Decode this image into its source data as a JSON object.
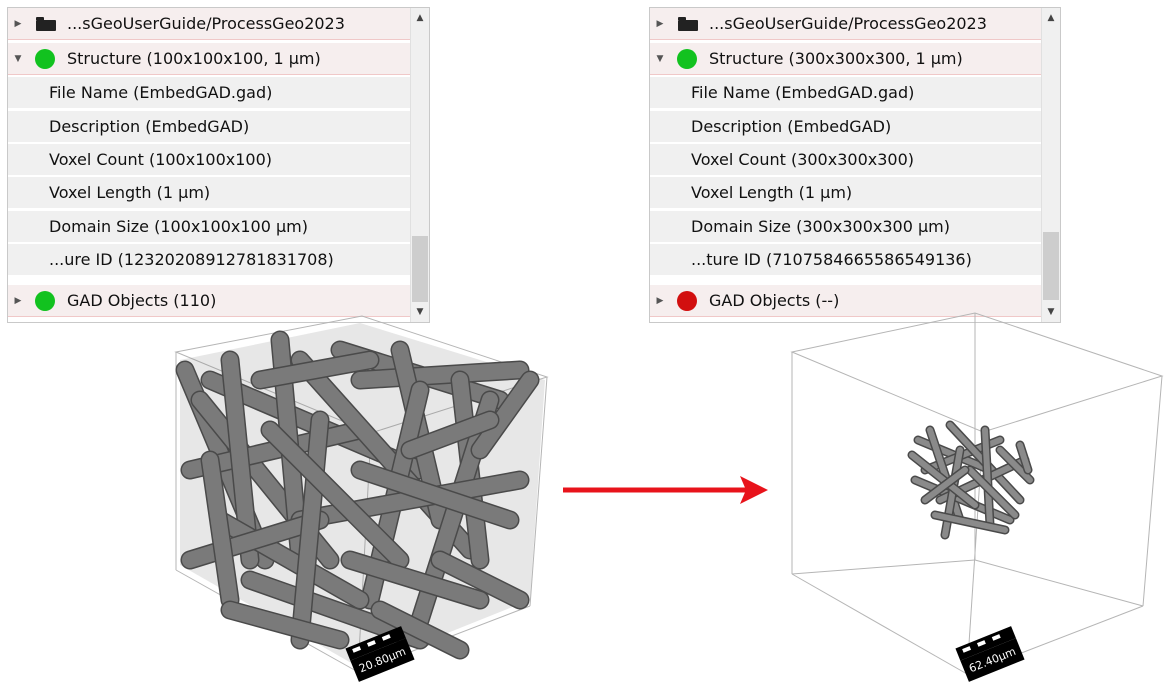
{
  "panels": {
    "left": {
      "rows": [
        {
          "type": "folder",
          "label": "...sGeoUserGuide/ProcessGeo2023",
          "expanded": false
        },
        {
          "type": "status",
          "label": "Structure (100x100x100, 1 µm)",
          "status": "green",
          "expanded": true
        },
        {
          "type": "child",
          "label": "File Name (EmbedGAD.gad)"
        },
        {
          "type": "child",
          "label": "Description (EmbedGAD)"
        },
        {
          "type": "child",
          "label": "Voxel Count (100x100x100)"
        },
        {
          "type": "child",
          "label": "Voxel Length (1 µm)"
        },
        {
          "type": "child",
          "label": "Domain Size (100x100x100 µm)"
        },
        {
          "type": "child",
          "label": "...ure ID (12320208912781831708)"
        },
        {
          "type": "status",
          "label": "GAD Objects (110)",
          "status": "green",
          "expanded": false
        }
      ]
    },
    "right": {
      "rows": [
        {
          "type": "folder",
          "label": "...sGeoUserGuide/ProcessGeo2023",
          "expanded": false
        },
        {
          "type": "status",
          "label": "Structure (300x300x300, 1 µm)",
          "status": "green",
          "expanded": true
        },
        {
          "type": "child",
          "label": "File Name (EmbedGAD.gad)"
        },
        {
          "type": "child",
          "label": "Description (EmbedGAD)"
        },
        {
          "type": "child",
          "label": "Voxel Count (300x300x300)"
        },
        {
          "type": "child",
          "label": "Voxel Length (1 µm)"
        },
        {
          "type": "child",
          "label": "Domain Size (300x300x300 µm)"
        },
        {
          "type": "child",
          "label": "...ture ID (7107584665586549136)"
        },
        {
          "type": "status",
          "label": "GAD Objects (--)",
          "status": "red",
          "expanded": false
        }
      ]
    }
  },
  "renders": {
    "left_scalebar": "20.80µm",
    "right_scalebar": "62.40µm"
  },
  "colors": {
    "status_green": "#12c21f",
    "status_red": "#d20f0f",
    "arrow": "#e8131b",
    "fiber": "#6e6e6e"
  },
  "icons": {
    "expand_collapsed": "triangle-right-icon",
    "expand_open": "triangle-down-icon",
    "folder": "folder-icon",
    "status": "status-dot-icon",
    "arrow": "right-arrow-icon"
  }
}
